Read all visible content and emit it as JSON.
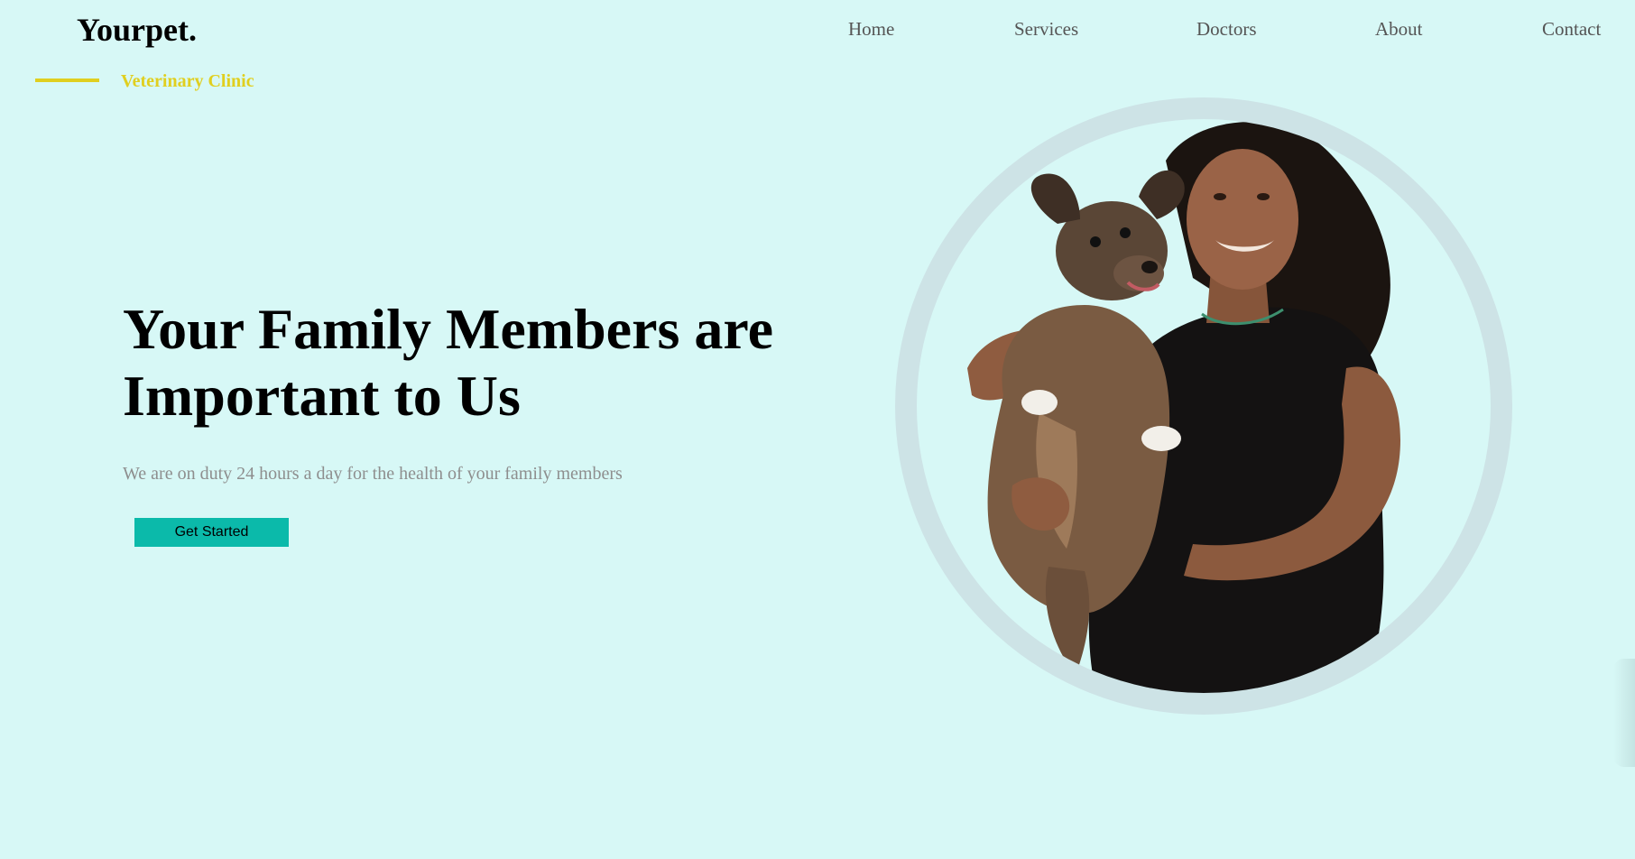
{
  "brand": {
    "logo": "Yourpet.",
    "tagline": "Veterinary Clinic"
  },
  "nav": {
    "items": [
      {
        "label": "Home"
      },
      {
        "label": "Services"
      },
      {
        "label": "Doctors"
      },
      {
        "label": "About"
      },
      {
        "label": "Contact"
      }
    ]
  },
  "hero": {
    "title_line1": "Your Family Members are",
    "title_line2": "Important to Us",
    "subtitle": "We are on duty 24 hours a day for the health of your family members",
    "cta_label": "Get Started"
  },
  "colors": {
    "background": "#d7f8f6",
    "accent": "#e0cf1f",
    "button": "#0bbaaa",
    "ring": "#cde3e6"
  },
  "icons": {
    "hero_image": "woman-holding-dog-photo"
  }
}
